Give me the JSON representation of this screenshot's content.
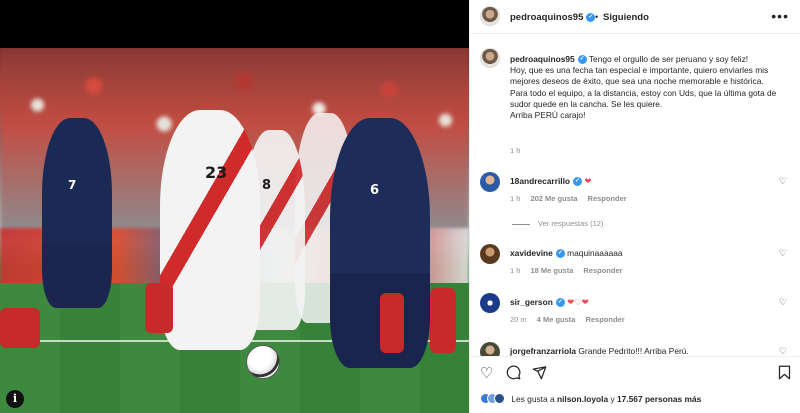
{
  "post": {
    "username": "pedroaquinos95",
    "verified_mark": "✓",
    "separator": "•",
    "follow_status": "Siguiendo",
    "more_icon": "more-options-icon",
    "caption_lines": [
      "Tengo el orgullo de ser peruano y soy feliz!",
      "Hoy, que es una fecha tan especial e importante, quiero enviarles mis mejores deseos de éxito, que sea una noche memorable e histórica.",
      "Para todo el equipo, a la distancia, estoy con Uds, que la última gota de sudor quede en la cancha. Se les quiere.",
      "Arriba PERÚ carajo!"
    ],
    "caption_time": "1 h"
  },
  "photo": {
    "jersey_numbers": [
      "23",
      "8",
      "6",
      "7"
    ],
    "info_icon": "i"
  },
  "comments": [
    {
      "username": "18andrecarrillo",
      "text": "❤",
      "time": "1 h",
      "likes": "202 Me gusta",
      "reply": "Responder",
      "view_replies": "Ver respuestas (12)",
      "avatar_color": "#2a5aa8"
    },
    {
      "username": "xavidevine",
      "text": "maquinaaaaaa",
      "time": "1 h",
      "likes": "18 Me gusta",
      "reply": "Responder",
      "avatar_color": "#8a5a2a"
    },
    {
      "username": "sir_gerson",
      "text": "❤♡❤",
      "time": "20 m",
      "likes": "4 Me gusta",
      "reply": "Responder",
      "avatar_color": "#1b3a8a"
    },
    {
      "username": "jorgefranzarriola",
      "text": "Grande Pedrito!!! Arriba Perú.",
      "avatar_color": "#6a6a5a"
    }
  ],
  "actions": {
    "like_icon": "heart-icon",
    "comment_icon": "comment-icon",
    "share_icon": "share-icon",
    "save_icon": "bookmark-icon",
    "likes_prefix": "Les gusta a",
    "likes_user": "nilson.loyola",
    "likes_middle": "y",
    "likes_count": "17.567 personas más"
  },
  "colors": {
    "verified": "#3897f0",
    "heart": "#ed4956",
    "muted": "#8e8e8e"
  }
}
